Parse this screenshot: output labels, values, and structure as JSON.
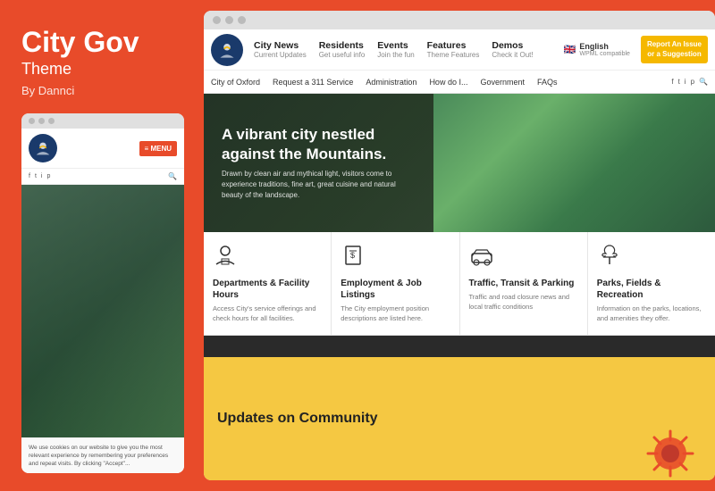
{
  "left": {
    "title_line1": "City Gov",
    "title_line2": "Theme",
    "byline": "By Dannci",
    "dots": [
      "dot1",
      "dot2",
      "dot3"
    ],
    "mobile_menu_label": "≡ MENU",
    "social_icons": [
      "f",
      "t",
      "i",
      "p"
    ],
    "cookie_text": "We use cookies on our website to give you the most relevant experience by remembering your preferences and repeat visits. By clicking \"Accept\"..."
  },
  "browser": {
    "dots": [
      "dot1",
      "dot2",
      "dot3"
    ]
  },
  "nav": {
    "items": [
      {
        "label": "City News",
        "sub": "Current Updates"
      },
      {
        "label": "Residents",
        "sub": "Get useful info"
      },
      {
        "label": "Events",
        "sub": "Join the fun"
      },
      {
        "label": "Features",
        "sub": "Theme Features"
      },
      {
        "label": "Demos",
        "sub": "Check it Out!"
      }
    ],
    "lang_label": "English",
    "lang_sub": "WPML compatible",
    "report_btn_line1": "Report An Issue",
    "report_btn_line2": "or a Suggestion"
  },
  "subnav": {
    "items": [
      "City of Oxford",
      "Request a 311 Service",
      "Administration",
      "How do I...",
      "Government",
      "FAQs"
    ],
    "social": [
      "f",
      "t",
      "i",
      "p",
      "🔍"
    ]
  },
  "hero": {
    "title": "A vibrant city nestled against the Mountains.",
    "body": "Drawn by clean air and mythical light, visitors come to experience traditions, fine art, great cuisine and natural beauty of the landscape."
  },
  "features": [
    {
      "icon": "👤",
      "title": "Departments & Facility Hours",
      "desc": "Access City's service offerings and check hours for all facilities."
    },
    {
      "icon": "💵",
      "title": "Employment & Job Listings",
      "desc": "The City employment position descriptions are listed here."
    },
    {
      "icon": "🚌",
      "title": "Traffic, Transit & Parking",
      "desc": "Traffic and road closure news and local traffic conditions"
    },
    {
      "icon": "🌿",
      "title": "Parks, Fields & Recreation",
      "desc": "Information on the parks, locations, and amenities they offer."
    }
  ],
  "updates": {
    "title": "Updates on Community"
  },
  "colors": {
    "accent": "#e84b2a",
    "nav_yellow": "#f5b800",
    "dark": "#2a2a2a",
    "logo_blue": "#1a3a6b"
  }
}
